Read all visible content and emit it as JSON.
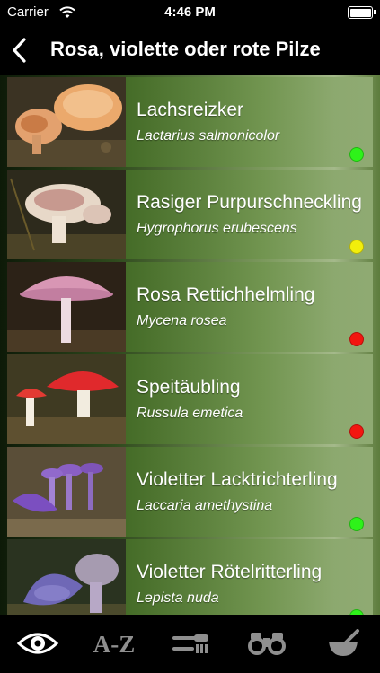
{
  "status": {
    "carrier": "Carrier",
    "time": "4:46 PM"
  },
  "nav": {
    "title": "Rosa, violette oder rote Pilze",
    "back_icon": "chevron-left-icon"
  },
  "colors": {
    "green": "#2ef21a",
    "yellow": "#f2ee0c",
    "red": "#f21610"
  },
  "rows": [
    {
      "name": "Lachsreizker",
      "latin": "Lactarius salmonicolor",
      "edibility": "green"
    },
    {
      "name": "Rasiger Purpurschneckling",
      "latin": "Hygrophorus erubescens",
      "edibility": "yellow"
    },
    {
      "name": "Rosa Rettichhelmling",
      "latin": "Mycena rosea",
      "edibility": "red"
    },
    {
      "name": "Speitäubling",
      "latin": "Russula emetica",
      "edibility": "red"
    },
    {
      "name": "Violetter Lacktrichterling",
      "latin": "Laccaria amethystina",
      "edibility": "green"
    },
    {
      "name": "Violetter Rötelritterling",
      "latin": "Lepista nuda",
      "edibility": "green"
    }
  ],
  "tabs": [
    {
      "icon": "eye-icon",
      "selected": true
    },
    {
      "label": "A-Z",
      "selected": false
    },
    {
      "icon": "cutlery-icon",
      "selected": false
    },
    {
      "icon": "binoculars-icon",
      "selected": false
    },
    {
      "icon": "mortar-pestle-icon",
      "selected": false
    }
  ]
}
